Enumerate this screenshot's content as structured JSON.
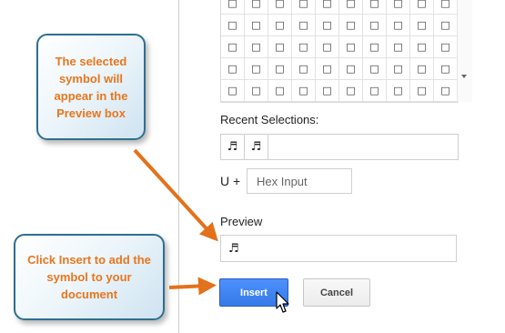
{
  "callouts": {
    "preview": "The selected symbol will appear in the Preview box",
    "insert": "Click Insert to add the symbol to your document"
  },
  "symbol_grid": {
    "cell_glyph": "□",
    "rows": 4,
    "cols": 10
  },
  "recent": {
    "label": "Recent Selections:",
    "items": [
      "♬",
      "♬"
    ]
  },
  "hex": {
    "label": "U +",
    "placeholder": "Hex Input"
  },
  "preview": {
    "label": "Preview",
    "value": "♬"
  },
  "buttons": {
    "insert": "Insert",
    "cancel": "Cancel"
  },
  "colors": {
    "callout_text": "#e8761d",
    "callout_border": "#2e6f8f",
    "arrow": "#e3711b",
    "insert_button": "#4d90fe"
  }
}
